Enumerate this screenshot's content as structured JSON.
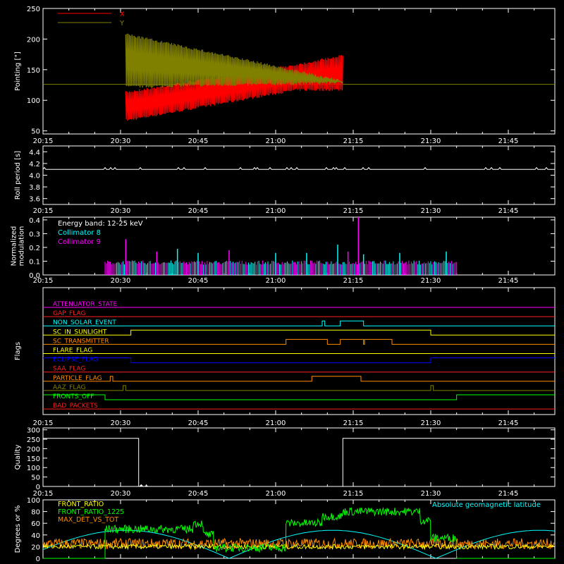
{
  "time_ticks": [
    "20:15",
    "20:30",
    "20:45",
    "21:00",
    "21:15",
    "21:30",
    "21:45"
  ],
  "colors": {
    "axes": "#ffffff",
    "x": "#ff0000",
    "y": "#808000",
    "c8": "#00ffff",
    "c9": "#ff00ff",
    "front_ratio": "#ffff00",
    "front_ratio_1225": "#00ff00",
    "max_det": "#ff8c00",
    "geomag": "#00ffff"
  },
  "chart_data": [
    {
      "id": "pointing",
      "type": "line",
      "ylabel": "Pointing [\"]",
      "ylim": [
        45,
        250
      ],
      "yticks": [
        "50",
        "100",
        "150",
        "200",
        "250"
      ],
      "xlim": [
        "20:15",
        "21:54"
      ],
      "legend": [
        {
          "name": "X",
          "color": "#ff0000"
        },
        {
          "name": "Y",
          "color": "#808000"
        }
      ],
      "baseline": 126,
      "oscillation": {
        "start": "20:31",
        "end": "21:13",
        "Y_envelope": [
          {
            "t": "20:31",
            "min": 120,
            "max": 210
          },
          {
            "t": "21:04",
            "min": 125,
            "max": 150
          },
          {
            "t": "21:13",
            "min": 127,
            "max": 133
          }
        ],
        "X_envelope": [
          {
            "t": "20:31",
            "min": 65,
            "max": 115
          },
          {
            "t": "21:04",
            "min": 115,
            "max": 160
          },
          {
            "t": "21:13",
            "min": 115,
            "max": 175
          }
        ]
      }
    },
    {
      "id": "roll",
      "type": "line",
      "ylabel": "Roll period [s]",
      "ylim": [
        3.5,
        4.5
      ],
      "yticks": [
        "3.6",
        "3.8",
        "4.0",
        "4.2",
        "4.4"
      ],
      "value": 4.1
    },
    {
      "id": "modulation",
      "type": "bar",
      "ylabel": "Normalized modulation",
      "ylim": [
        0,
        0.42
      ],
      "yticks": [
        "0.0",
        "0.1",
        "0.2",
        "0.3",
        "0.4"
      ],
      "annotation": "Energy band: 12-25 keV",
      "series": [
        {
          "name": "Collimator 8",
          "color": "#00ffff"
        },
        {
          "name": "Collimator 9",
          "color": "#ff00ff"
        }
      ],
      "active_range": [
        "20:27",
        "21:35"
      ],
      "typical": 0.09,
      "spikes": [
        {
          "t": "20:31",
          "v": 0.26,
          "s": 1
        },
        {
          "t": "20:37",
          "v": 0.17,
          "s": 1
        },
        {
          "t": "20:41",
          "v": 0.19,
          "s": 0
        },
        {
          "t": "20:45",
          "v": 0.16,
          "s": 0
        },
        {
          "t": "20:51",
          "v": 0.18,
          "s": 1
        },
        {
          "t": "21:00",
          "v": 0.16,
          "s": 0
        },
        {
          "t": "21:06",
          "v": 0.16,
          "s": 0
        },
        {
          "t": "21:12",
          "v": 0.22,
          "s": 0
        },
        {
          "t": "21:14",
          "v": 0.17,
          "s": 1
        },
        {
          "t": "21:16",
          "v": 0.42,
          "s": 1
        },
        {
          "t": "21:17",
          "v": 0.15,
          "s": 0
        },
        {
          "t": "21:24",
          "v": 0.16,
          "s": 0
        },
        {
          "t": "21:33",
          "v": 0.17,
          "s": 0
        }
      ]
    },
    {
      "id": "flags",
      "type": "table",
      "ylabel": "Flags",
      "rows": [
        {
          "label": "ATTENUATOR_STATE",
          "color": "#ff00ff",
          "on": []
        },
        {
          "label": "GAP_FLAG",
          "color": "#ff2020",
          "on": []
        },
        {
          "label": "NON_SOLAR_EVENT",
          "color": "#00ffff",
          "on": [
            [
              "21:09",
              "21:09.5"
            ],
            [
              "21:12.5",
              "21:17"
            ]
          ]
        },
        {
          "label": "SC_IN_SUNLIGHT",
          "color": "#ffff00",
          "on": [
            [
              "20:32",
              "21:30"
            ]
          ]
        },
        {
          "label": "SC_TRANSMITTER",
          "color": "#ff8c00",
          "on": [
            [
              "21:02",
              "21:10"
            ],
            [
              "21:12.5",
              "21:17"
            ],
            [
              "21:17.2",
              "21:22.5"
            ]
          ]
        },
        {
          "label": "FLARE_FLAG",
          "color": "#ffff00",
          "on": []
        },
        {
          "label": "ECLIPSE_FLAG",
          "color": "#0000ff",
          "on": [
            [
              "20:15",
              "20:32"
            ],
            [
              "21:30",
              "21:54"
            ]
          ]
        },
        {
          "label": "SAA_FLAG",
          "color": "#ff2020",
          "on": []
        },
        {
          "label": "PARTICLE_FLAG",
          "color": "#ff8c00",
          "on": [
            [
              "20:28",
              "20:28.5"
            ],
            [
              "21:07",
              "21:16.5"
            ]
          ]
        },
        {
          "label": "AAZ_FLAG",
          "color": "#808000",
          "on": [
            [
              "20:30.5",
              "20:31"
            ],
            [
              "21:30",
              "21:30.5"
            ]
          ]
        },
        {
          "label": "FRONTS_OFF",
          "color": "#00ff00",
          "on": [
            [
              "20:15",
              "20:27"
            ],
            [
              "21:35",
              "21:54"
            ]
          ]
        },
        {
          "label": "BAD_PACKETS",
          "color": "#ff2020",
          "on": []
        }
      ]
    },
    {
      "id": "quality",
      "type": "area",
      "ylabel": "Quality",
      "ylim": [
        0,
        310
      ],
      "yticks": [
        "0",
        "50",
        "100",
        "150",
        "200",
        "250",
        "300"
      ],
      "segments": [
        {
          "from": "20:15",
          "to": "20:33.5",
          "value": 255
        },
        {
          "from": "20:33.5",
          "to": "21:13",
          "value": 0
        },
        {
          "from": "21:13",
          "to": "21:54",
          "value": 255
        }
      ],
      "blips": [
        {
          "t": "20:34",
          "v": 12
        },
        {
          "t": "20:35",
          "v": 8
        }
      ]
    },
    {
      "id": "ratios",
      "type": "line",
      "ylabel": "Degrees or %",
      "ylim": [
        0,
        100
      ],
      "yticks": [
        "0",
        "20",
        "40",
        "60",
        "80",
        "100"
      ],
      "series": [
        {
          "name": "FRONT_RATIO",
          "color": "#ffff00"
        },
        {
          "name": "FRONT_RATIO_1225",
          "color": "#00ff00"
        },
        {
          "name": "MAX_DET_VS_TOT",
          "color": "#ff8c00"
        }
      ],
      "annotation": "Absolute geomagnetic latitude",
      "front_ratio_1225_profile": [
        {
          "from": "20:27",
          "to": "20:44",
          "v": 50
        },
        {
          "from": "20:44",
          "to": "20:46",
          "v": 60
        },
        {
          "from": "20:46",
          "to": "20:48",
          "v": 40
        },
        {
          "from": "20:48",
          "to": "21:02",
          "v": 18
        },
        {
          "from": "21:02",
          "to": "21:09",
          "v": 60
        },
        {
          "from": "21:09",
          "to": "21:13",
          "v": 72
        },
        {
          "from": "21:13",
          "to": "21:28",
          "v": 80
        },
        {
          "from": "21:28",
          "to": "21:30",
          "v": 65
        },
        {
          "from": "21:30",
          "to": "21:35",
          "v": 35
        }
      ],
      "geomag_peak": 48,
      "geomag_peak_times": [
        "20:31",
        "21:11"
      ],
      "max_det_level": 25,
      "front_ratio_level": 20
    }
  ]
}
